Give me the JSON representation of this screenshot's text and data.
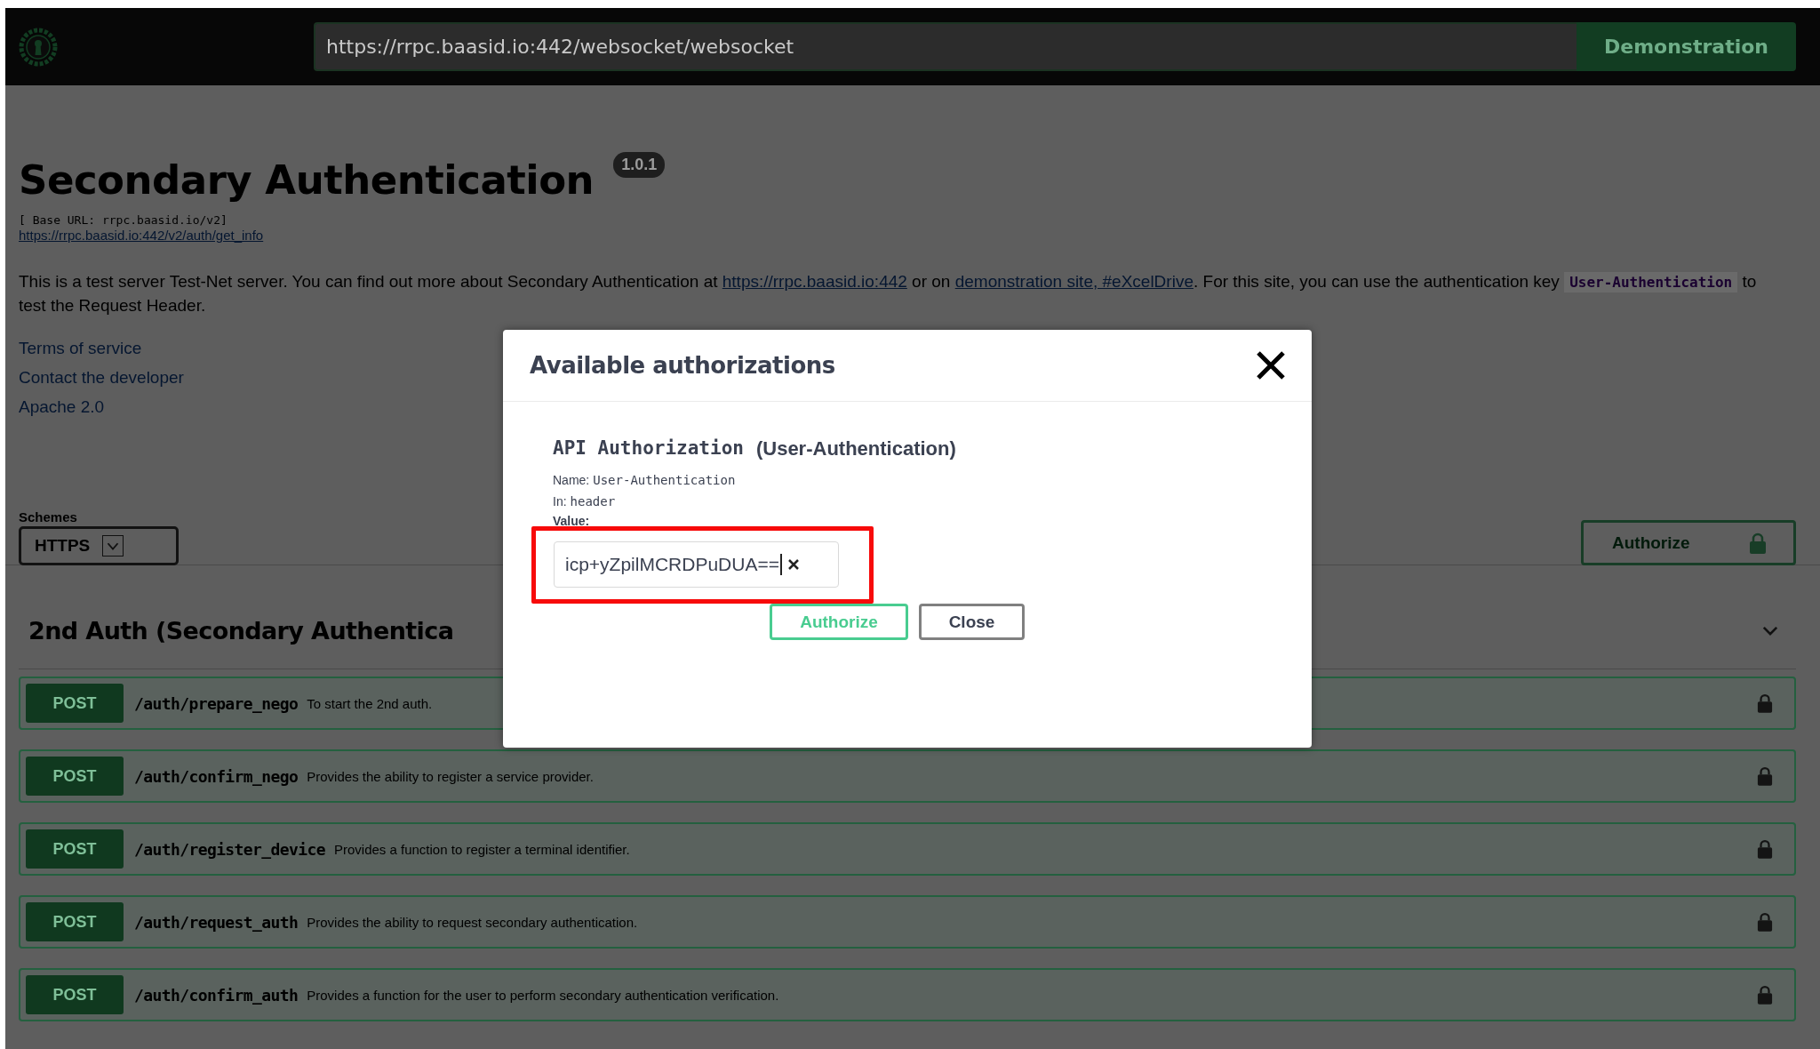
{
  "header": {
    "url": "https://rrpc.baasid.io:442/websocket/websocket",
    "button": "Demonstration"
  },
  "info": {
    "title": "Secondary Authentication",
    "version": "1.0.1",
    "base_url": "[ Base URL: rrpc.baasid.io/v2]",
    "spec_link": "https://rrpc.baasid.io:442/v2/auth/get_info",
    "description": [
      {
        "kind": "text",
        "text": "This is a test server Test-Net server. You can find out more about Secondary Authentication at "
      },
      {
        "kind": "link",
        "text": "https://rrpc.baasid.io:442"
      },
      {
        "kind": "text",
        "text": " or on "
      },
      {
        "kind": "link",
        "text": "demonstration site, #eXcelDrive"
      },
      {
        "kind": "text",
        "text": ". For this site, you can use the authentication key "
      },
      {
        "kind": "code",
        "text": "User-Authentication"
      },
      {
        "kind": "text",
        "text": " to test the Request Header."
      }
    ],
    "links": [
      "Terms of service",
      "Contact the developer",
      "Apache 2.0"
    ]
  },
  "schemes": {
    "label": "Schemes",
    "value": "HTTPS"
  },
  "authorize_button": "Authorize",
  "section": {
    "title": "2nd Auth (Secondary Authentica"
  },
  "operations": [
    {
      "method": "POST",
      "path": "/auth/prepare_nego",
      "summary": "To start the 2nd auth."
    },
    {
      "method": "POST",
      "path": "/auth/confirm_nego",
      "summary": "Provides the ability to register a service provider."
    },
    {
      "method": "POST",
      "path": "/auth/register_device",
      "summary": "Provides a function to register a terminal identifier."
    },
    {
      "method": "POST",
      "path": "/auth/request_auth",
      "summary": "Provides the ability to request secondary authentication."
    },
    {
      "method": "POST",
      "path": "/auth/confirm_auth",
      "summary": "Provides a function for the user to perform secondary authentication verification."
    }
  ],
  "dialog": {
    "title": "Available authorizations",
    "auth_name": "API Authorization",
    "auth_scheme": "(User-Authentication)",
    "fields": [
      {
        "label": "Name:",
        "value": "User-Authentication"
      },
      {
        "label": "In:",
        "value": "header"
      }
    ],
    "value_label": "Value:",
    "value": "icp+yZpilMCRDPuDUA==",
    "highlighted": true,
    "buttons": [
      {
        "label": "Authorize",
        "kind": "primary"
      },
      {
        "label": "Close",
        "kind": "secondary"
      }
    ]
  }
}
